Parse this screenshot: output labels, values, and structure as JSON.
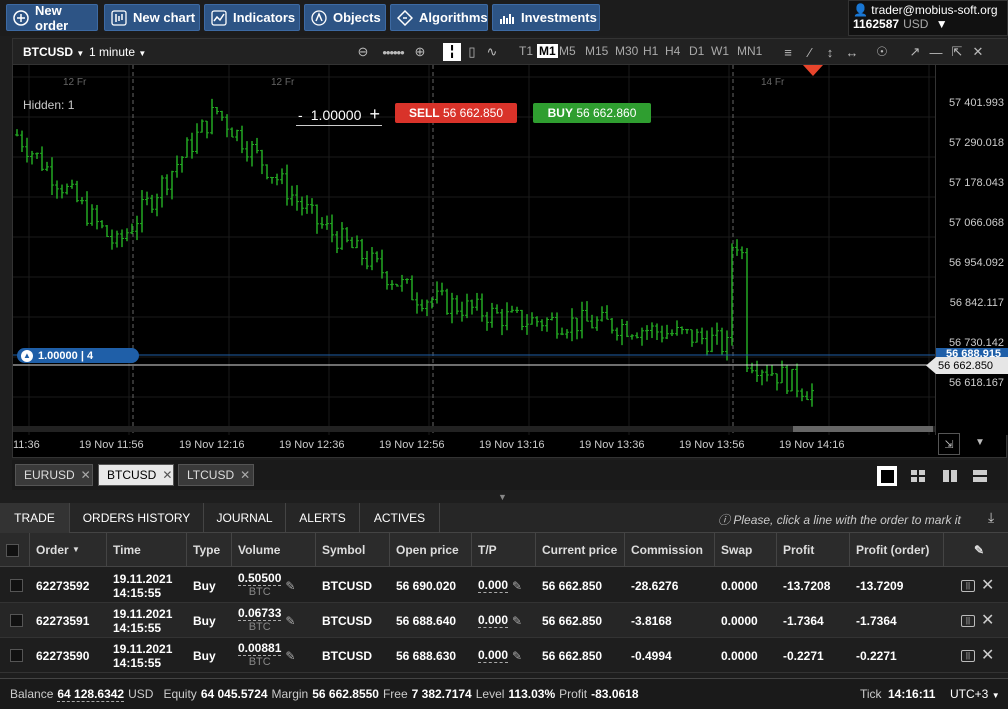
{
  "toolbar": {
    "buttons": [
      {
        "label": "New order",
        "icon": "plus-circle-icon"
      },
      {
        "label": "New chart",
        "icon": "chart-icon"
      },
      {
        "label": "Indicators",
        "icon": "indicators-icon"
      },
      {
        "label": "Objects",
        "icon": "objects-icon"
      },
      {
        "label": "Algorithms",
        "icon": "algorithms-icon"
      },
      {
        "label": "Investments",
        "icon": "investments-icon"
      }
    ]
  },
  "account": {
    "email": "trader@mobius-soft.org",
    "id": "1162587",
    "currency": "USD"
  },
  "chart": {
    "symbol": "BTCUSD",
    "timeframe": "1 minute",
    "timeframes": [
      "T1",
      "M1",
      "M5",
      "M15",
      "M30",
      "H1",
      "H4",
      "D1",
      "W1",
      "MN1"
    ],
    "active_timeframe": "M1",
    "hidden_label": "Hidden: 1",
    "day_labels": [
      "12 Fr",
      "12 Fr",
      "14 Fr"
    ],
    "quantity": "1.00000",
    "qty_minus": "-",
    "qty_plus": "+",
    "sell_label": "SELL",
    "sell_price": "56 662.850",
    "buy_label": "BUY",
    "buy_price": "56 662.860",
    "position_label": "1.00000 | 4",
    "y_ticks": [
      "57 401.993",
      "57 290.018",
      "57 178.043",
      "57 066.068",
      "56 954.092",
      "56 842.117",
      "56 730.142",
      "56 618.167"
    ],
    "price_marker_hidden": "56 688.915",
    "price_marker": "56 662.850",
    "x_ticks": [
      "11:36",
      "19 Nov 11:56",
      "19 Nov 12:16",
      "19 Nov 12:36",
      "19 Nov 12:56",
      "19 Nov 13:16",
      "19 Nov 13:36",
      "19 Nov 13:56",
      "19 Nov 14:16"
    ],
    "colors": {
      "up": "#22a822",
      "down": "#22a822",
      "bg": "#000000",
      "position": "#1f5fa8"
    }
  },
  "chart_data": {
    "type": "ohlc",
    "symbol": "BTCUSD",
    "x": [
      "11:36",
      "11:56",
      "12:16",
      "12:36",
      "12:56",
      "13:16",
      "13:36",
      "13:56",
      "14:16"
    ],
    "close": [
      57290,
      57020,
      57350,
      57080,
      56900,
      56840,
      56830,
      56790,
      56662.85
    ],
    "ylim": [
      56560,
      57460
    ],
    "current_price": 56662.85,
    "position_price": 56688.915
  },
  "symbol_tabs": [
    "EURUSD",
    "BTCUSD",
    "LTCUSD"
  ],
  "active_symbol_tab": "BTCUSD",
  "bottom": {
    "tabs": [
      "TRADE",
      "ORDERS HISTORY",
      "JOURNAL",
      "ALERTS",
      "ACTIVES"
    ],
    "active_tab": "TRADE",
    "hint": "Please, click a line with the order to mark it",
    "headers": [
      "Order",
      "Time",
      "Type",
      "Volume",
      "Symbol",
      "Open price",
      "T/P",
      "Current price",
      "Commission",
      "Swap",
      "Profit",
      "Profit (order)"
    ],
    "rows": [
      {
        "order": "62273592",
        "date": "19.11.2021",
        "time": "14:15:55",
        "type": "Buy",
        "volume": "0.50500",
        "unit": "BTC",
        "symbol": "BTCUSD",
        "open": "56 690.020",
        "tp": "0.000",
        "current": "56 662.850",
        "commission": "-28.6276",
        "swap": "0.0000",
        "profit": "-13.7208",
        "profit_order": "-13.7209"
      },
      {
        "order": "62273591",
        "date": "19.11.2021",
        "time": "14:15:55",
        "type": "Buy",
        "volume": "0.06733",
        "unit": "BTC",
        "symbol": "BTCUSD",
        "open": "56 688.640",
        "tp": "0.000",
        "current": "56 662.850",
        "commission": "-3.8168",
        "swap": "0.0000",
        "profit": "-1.7364",
        "profit_order": "-1.7364"
      },
      {
        "order": "62273590",
        "date": "19.11.2021",
        "time": "14:15:55",
        "type": "Buy",
        "volume": "0.00881",
        "unit": "BTC",
        "symbol": "BTCUSD",
        "open": "56 688.630",
        "tp": "0.000",
        "current": "56 662.850",
        "commission": "-0.4994",
        "swap": "0.0000",
        "profit": "-0.2271",
        "profit_order": "-0.2271"
      }
    ]
  },
  "status": {
    "balance_label": "Balance",
    "balance": "64 128.6342",
    "balance_cur": "USD",
    "equity_label": "Equity",
    "equity": "64 045.5724",
    "margin_label": "Margin",
    "margin": "56 662.8550",
    "free_label": "Free",
    "free": "7 382.7174",
    "level_label": "Level",
    "level": "113.03%",
    "profit_label": "Profit",
    "profit": "-83.0618",
    "tick_label": "Tick",
    "tick": "14:16:11",
    "tz": "UTC+3"
  }
}
